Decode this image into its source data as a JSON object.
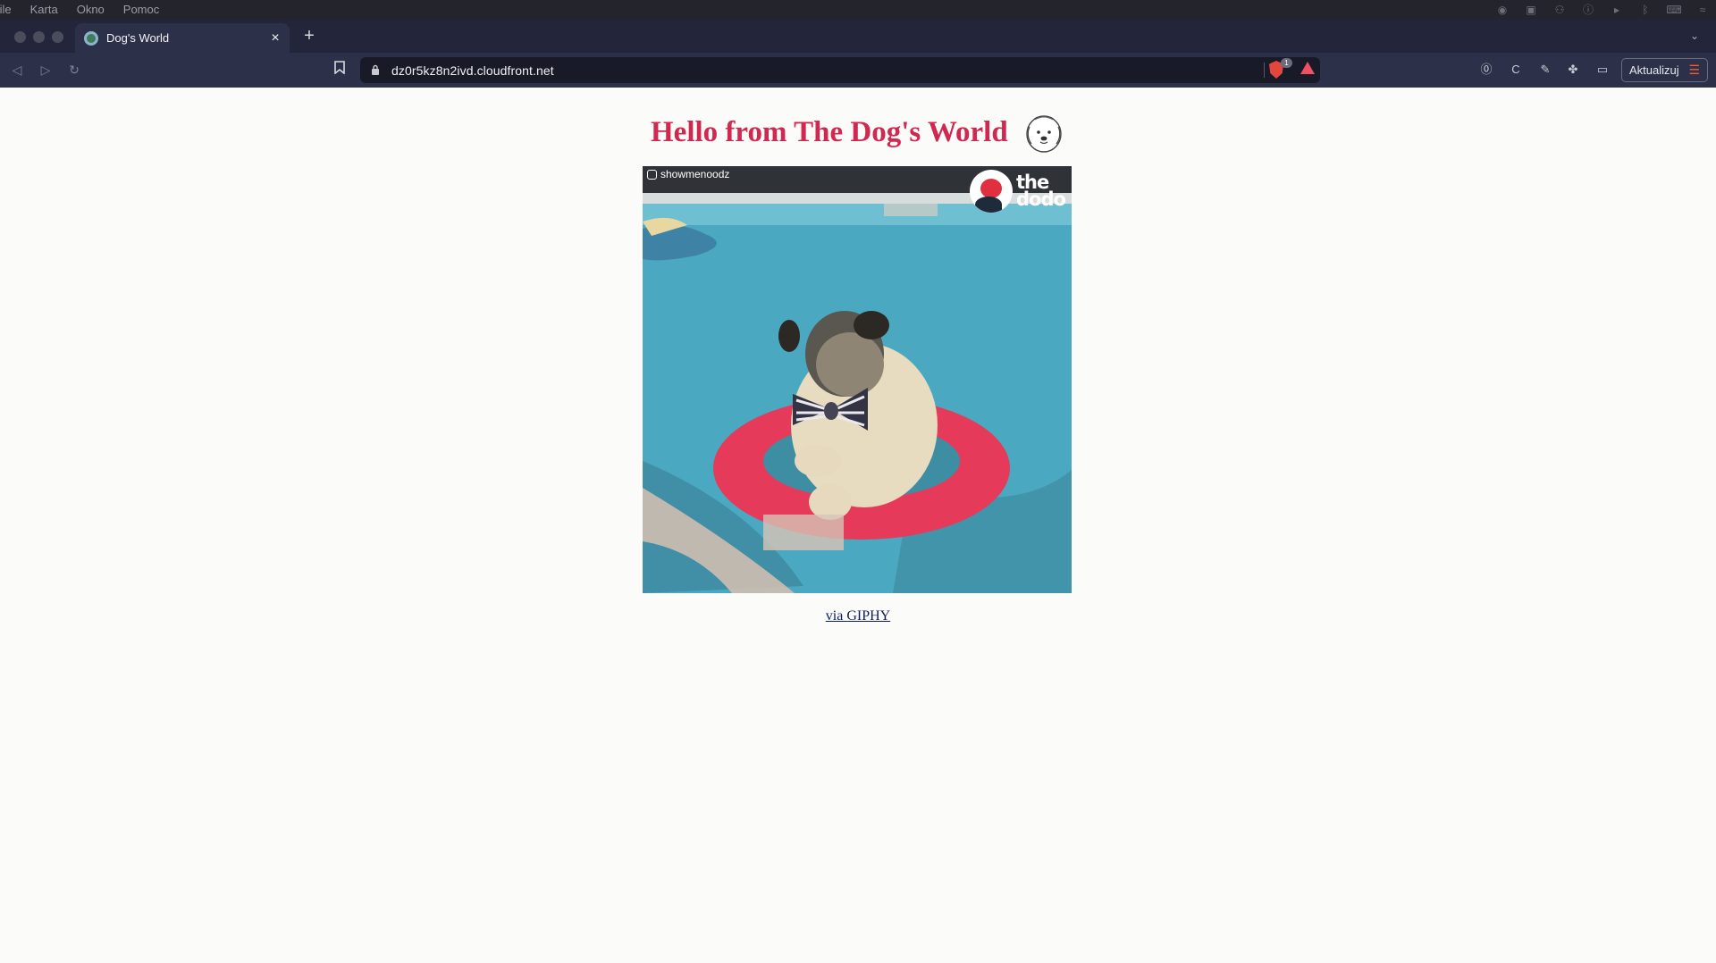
{
  "menubar": {
    "items": [
      "file",
      "Karta",
      "Okno",
      "Pomoc"
    ]
  },
  "tab": {
    "title": "Dog's World",
    "close_label": "×",
    "new_tab_label": "+"
  },
  "toolbar": {
    "url": "dz0r5kz8n2ivd.cloudfront.net",
    "shield_count": "1",
    "update_label": "Aktualizuj"
  },
  "page": {
    "heading": "Hello from The Dog's World",
    "gif_credit": "showmenoodz",
    "gif_logo": "the dodo",
    "via_prefix": "via ",
    "via_link": "GIPHY"
  },
  "icons": {
    "back": "back-arrow-icon",
    "forward": "forward-arrow-icon",
    "reload": "reload-icon",
    "bookmark": "bookmark-icon",
    "lock": "lock-icon",
    "shield": "brave-shield-icon",
    "rewards": "brave-rewards-icon",
    "dog": "dog-face-icon"
  },
  "colors": {
    "heading": "#d0294f",
    "link": "#0e1e5b",
    "chrome_dark": "#23253a",
    "toolbar": "#2d3049",
    "update_accent": "#f25c35"
  }
}
